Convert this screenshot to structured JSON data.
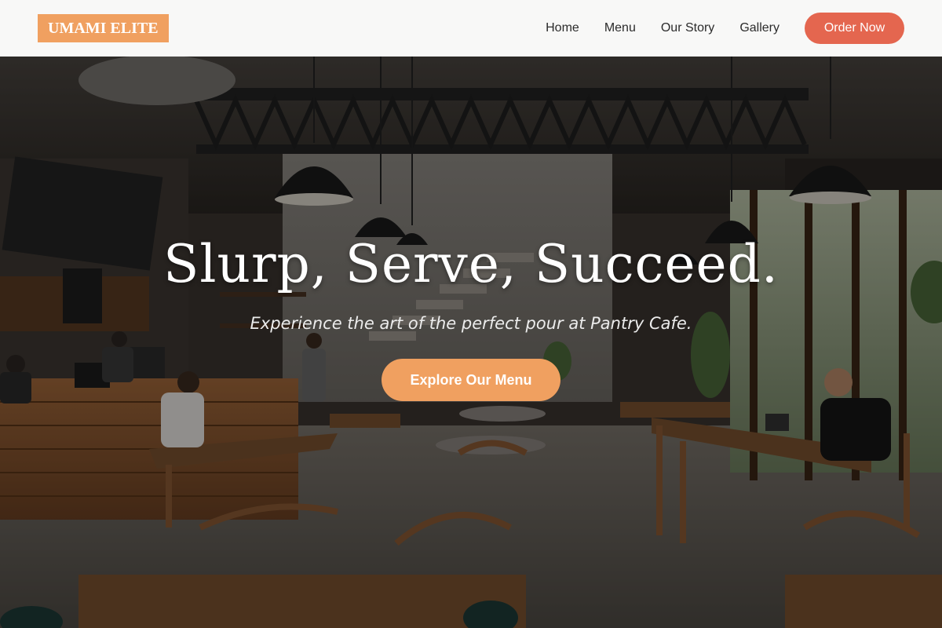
{
  "brand": {
    "logo_text": "UMAMI ELITE"
  },
  "nav": {
    "items": [
      {
        "label": "Home"
      },
      {
        "label": "Menu"
      },
      {
        "label": "Our Story"
      },
      {
        "label": "Gallery"
      }
    ],
    "cta_label": "Order Now"
  },
  "hero": {
    "title": "Slurp, Serve, Succeed.",
    "subtitle": "Experience the art of the perfect pour at Pantry Cafe.",
    "button_label": "Explore Our Menu",
    "background_image": "cafe-interior-photo"
  },
  "colors": {
    "accent": "#f0a060",
    "cta": "#e4664f",
    "header_bg": "#f8f8f7"
  }
}
